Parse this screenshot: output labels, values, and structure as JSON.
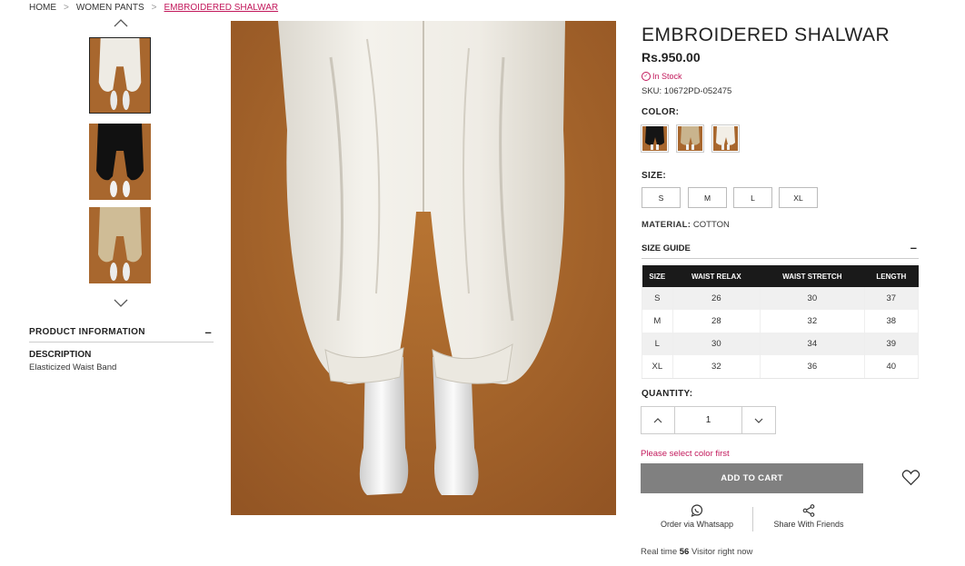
{
  "breadcrumb": {
    "home": "HOME",
    "category": "WOMEN PANTS",
    "current": "EMBROIDERED SHALWAR"
  },
  "product": {
    "title": "EMBROIDERED SHALWAR",
    "price": "Rs.950.00",
    "stock": "In Stock",
    "sku": "SKU: 10672PD-052475"
  },
  "thumbnails": [
    {
      "color": "white",
      "active": true
    },
    {
      "color": "black",
      "active": false
    },
    {
      "color": "beige",
      "active": false
    }
  ],
  "product_info": {
    "heading": "PRODUCT INFORMATION",
    "desc_label": "DESCRIPTION",
    "desc_text": "Elasticized Waist Band"
  },
  "color": {
    "label": "COLOR:",
    "swatches": [
      "#151515",
      "#c9b48e",
      "#f2eee6"
    ]
  },
  "size": {
    "label": "SIZE:",
    "options": [
      "S",
      "M",
      "L",
      "XL"
    ]
  },
  "material": {
    "label": "MATERIAL:",
    "value": "COTTON"
  },
  "size_guide": {
    "heading": "SIZE GUIDE",
    "columns": [
      "SIZE",
      "WAIST RELAX",
      "WAIST STRETCH",
      "LENGTH"
    ],
    "rows": [
      [
        "S",
        "26",
        "30",
        "37"
      ],
      [
        "M",
        "28",
        "32",
        "38"
      ],
      [
        "L",
        "30",
        "34",
        "39"
      ],
      [
        "XL",
        "32",
        "36",
        "40"
      ]
    ]
  },
  "quantity": {
    "label": "QUANTITY:",
    "value": "1"
  },
  "cart": {
    "warning": "Please select color first",
    "button": "ADD TO CART"
  },
  "share": {
    "whatsapp": "Order via Whatsapp",
    "friends": "Share With Friends"
  },
  "visitors": {
    "prefix": "Real time",
    "count": "56",
    "suffix": "Visitor right now"
  },
  "colors": {
    "accent": "#c2185b",
    "cart_button": "#808080",
    "table_header": "#1a1a1a",
    "photo_background": "#a8672e"
  }
}
